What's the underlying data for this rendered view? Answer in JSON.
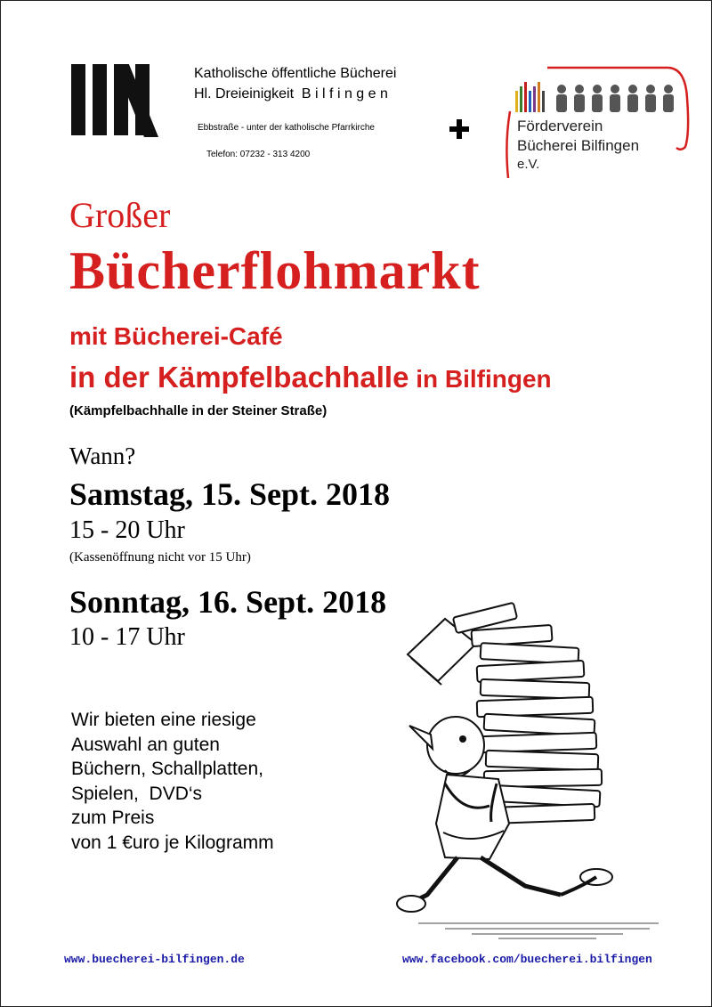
{
  "library": {
    "name_line1": "Katholische öffentliche Bücherei",
    "name_line2": "Hl. Dreieinigkeit  B i l f i n g e n",
    "address": "Ebbstraße  -  unter der katholische Pfarrkirche",
    "phone": "Telefon: 07232 - 313 4200"
  },
  "foerderverein": {
    "line1": "Förderverein",
    "line2": "Bücherei Bilfingen",
    "line3": "e.V.",
    "book_colors": [
      "#e0b020",
      "#3a7d2a",
      "#c21f1f",
      "#1f5fbf",
      "#7a3a8a",
      "#d07a20",
      "#444444"
    ]
  },
  "headline": {
    "line1": "Großer",
    "line2": "Bücherflohmarkt",
    "line3": "mit Bücherei-Café",
    "line4_bold": "in der Kämpfelbachhalle",
    "line4_rest": " in Bilfingen",
    "location_note": "(Kämpfelbachhalle in der Steiner Straße)"
  },
  "schedule": {
    "question": "Wann?",
    "day1": "Samstag, 15. Sept. 2018",
    "day1_time": "15 - 20 Uhr",
    "day1_note": "(Kassenöffnung nicht vor 15 Uhr)",
    "day2": "Sonntag, 16. Sept. 2018",
    "day2_time": "10 - 17 Uhr"
  },
  "offer": {
    "lines": [
      "Wir bieten eine riesige",
      "Auswahl an guten",
      "Büchern, Schallplatten,",
      "Spielen,  DVD‘s",
      "zum Preis",
      "von 1 €uro je Kilogramm"
    ]
  },
  "footer": {
    "website": "www.buecherei-bilfingen.de",
    "facebook": "www.facebook.com/buecherei.bilfingen"
  }
}
